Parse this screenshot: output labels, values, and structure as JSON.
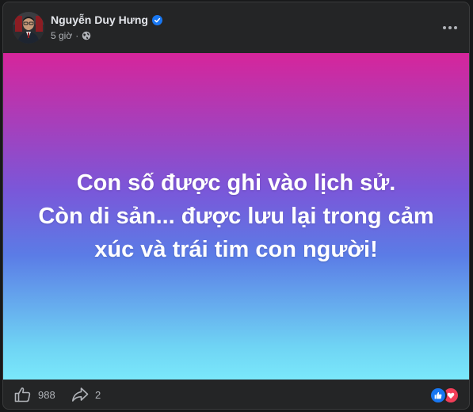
{
  "post": {
    "author": "Nguyễn Duy Hưng",
    "time": "5 giờ",
    "separator": "·",
    "privacy_icon": "globe-icon",
    "text_lines": [
      "Con số được ghi vào lịch sử.",
      "Còn di sản... được lưu lại trong cảm",
      "xúc và trái tim con người!"
    ],
    "background_gradient": [
      "#d6259b",
      "#7a57d9",
      "#5b7ce6",
      "#7ae8fb"
    ]
  },
  "footer": {
    "like_count": "988",
    "share_count": "2",
    "reactions": [
      "like-icon",
      "love-icon"
    ]
  },
  "colors": {
    "card_bg": "#242526",
    "verified": "#1877f2",
    "like": "#1877f2",
    "love": "#f33e58"
  }
}
